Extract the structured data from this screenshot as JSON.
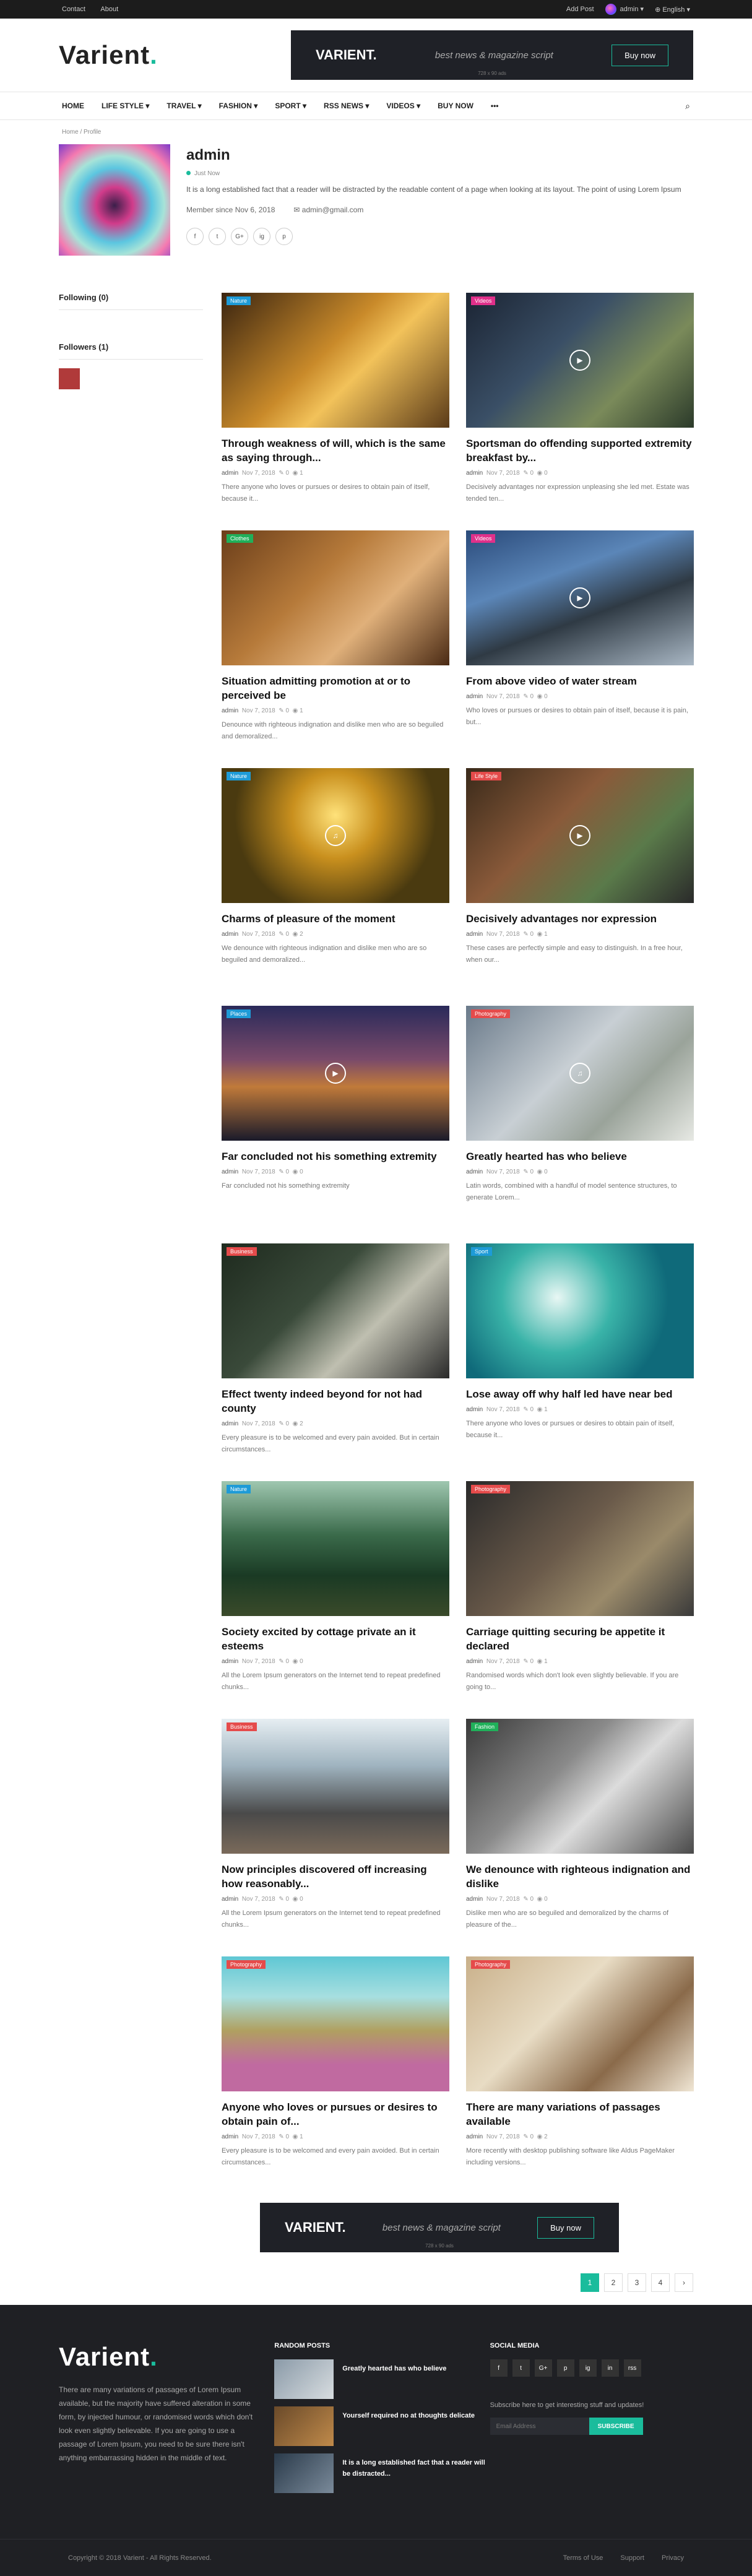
{
  "topbar": {
    "links": [
      "Contact",
      "About"
    ],
    "add_post": "Add Post",
    "user": "admin",
    "language": "English"
  },
  "header": {
    "logo": "Varient",
    "logo_dot": "."
  },
  "banner": {
    "logo": "VARIENT.",
    "tagline": "best news & magazine script",
    "button": "Buy now",
    "size": "728 x 90 ads"
  },
  "nav": {
    "items": [
      "HOME",
      "LIFE STYLE ▾",
      "TRAVEL ▾",
      "FASHION ▾",
      "SPORT ▾",
      "RSS NEWS ▾",
      "VIDEOS ▾",
      "BUY NOW",
      "•••"
    ]
  },
  "breadcrumb": "Home / Profile",
  "profile": {
    "name": "admin",
    "status": "Just Now",
    "bio": "It is a long established fact that a reader will be distracted by the readable content of a page when looking at its layout. The point of using Lorem Ipsum",
    "member_since": "Member since Nov 6, 2018",
    "email": "admin@gmail.com",
    "socials": [
      "f",
      "t",
      "G+",
      "ig",
      "p"
    ]
  },
  "sidebar": {
    "following": "Following (0)",
    "followers": "Followers (1)"
  },
  "posts": [
    {
      "badge": "Nature",
      "badge_color": "#1e9bd7",
      "title": "Through weakness of will, which is the same as saying through...",
      "author": "admin",
      "date": "Nov 7, 2018",
      "comments": "0",
      "views": "1",
      "excerpt": "There anyone who loves or pursues or desires to obtain pain of itself, because it...",
      "img": "linear-gradient(135deg,#3a2410,#c98a2a 45%,#f2c25a 60%,#5a3a18)",
      "play": ""
    },
    {
      "badge": "Videos",
      "badge_color": "#e0308a",
      "title": "Sportsman do offending supported extremity breakfast by...",
      "author": "admin",
      "date": "Nov 7, 2018",
      "comments": "0",
      "views": "0",
      "excerpt": "Decisively advantages nor expression unpleasing she led met. Estate was tended ten...",
      "img": "linear-gradient(135deg,#1b2433,#3a4f66 40%,#7a8a5a 70%,#2b3a2a)",
      "play": "▶"
    },
    {
      "badge": "Clothes",
      "badge_color": "#20b05a",
      "title": "Situation admitting promotion at or to perceived be",
      "author": "admin",
      "date": "Nov 7, 2018",
      "comments": "0",
      "views": "1",
      "excerpt": "Denounce with righteous indignation and dislike men who are so beguiled and demoralized...",
      "img": "linear-gradient(135deg,#6b3e1a,#b67a3a 40%,#e0b07a 65%,#4a2a14)",
      "play": ""
    },
    {
      "badge": "Videos",
      "badge_color": "#e0308a",
      "title": "From above video of water stream",
      "author": "admin",
      "date": "Nov 7, 2018",
      "comments": "0",
      "views": "0",
      "excerpt": "Who loves or pursues or desires to obtain pain of itself, because it is pain, but...",
      "img": "linear-gradient(160deg,#2a4a7a,#5b86b8 35%,#2f3a44 60%,#a9b7c4)",
      "play": "▶"
    },
    {
      "badge": "Nature",
      "badge_color": "#1e9bd7",
      "title": "Charms of pleasure of the moment",
      "author": "admin",
      "date": "Nov 7, 2018",
      "comments": "0",
      "views": "2",
      "excerpt": "We denounce with righteous indignation and dislike men who are so beguiled and demoralized...",
      "img": "radial-gradient(circle at 50% 35%,#ffe27a,#c9901e 30%,#4a3a10 70%)",
      "play": "♫"
    },
    {
      "badge": "Life Style",
      "badge_color": "#e54b4b",
      "title": "Decisively advantages nor expression",
      "author": "admin",
      "date": "Nov 7, 2018",
      "comments": "0",
      "views": "1",
      "excerpt": "These cases are perfectly simple and easy to distinguish. In a free hour, when our...",
      "img": "linear-gradient(135deg,#3a2a1a,#8a5a3a 40%,#5a7a4a 70%,#2a2a2a)",
      "play": "▶"
    },
    {
      "badge": "Places",
      "badge_color": "#1e9bd7",
      "title": "Far concluded not his something extremity",
      "author": "admin",
      "date": "Nov 7, 2018",
      "comments": "0",
      "views": "0",
      "excerpt": "Far concluded not his something extremity",
      "img": "linear-gradient(180deg,#2a2a5a,#7a4a6a 40%,#c07a3a 60%,#1a1a2a)",
      "play": "▶"
    },
    {
      "badge": "Photography",
      "badge_color": "#e54b4b",
      "title": "Greatly hearted has who believe",
      "author": "admin",
      "date": "Nov 7, 2018",
      "comments": "0",
      "views": "0",
      "excerpt": "Latin words, combined with a handful of model sentence structures, to generate Lorem...",
      "img": "linear-gradient(135deg,#6a7a8a,#c8cfd4 45%,#9aa39a 70%,#e7e9e4)",
      "play": "♫"
    },
    {
      "badge": "Business",
      "badge_color": "#e54b4b",
      "title": "Effect twenty indeed beyond for not had county",
      "author": "admin",
      "date": "Nov 7, 2018",
      "comments": "0",
      "views": "2",
      "excerpt": "Every pleasure is to be welcomed and every pain avoided. But in certain circumstances...",
      "img": "linear-gradient(135deg,#1e2a1e,#3a4a3a 40%,#bfbfb0 65%,#2a2a2a)",
      "play": ""
    },
    {
      "badge": "Sport",
      "badge_color": "#1e9bd7",
      "title": "Lose away off why half led have near bed",
      "author": "admin",
      "date": "Nov 7, 2018",
      "comments": "0",
      "views": "1",
      "excerpt": "There anyone who loves or pursues or desires to obtain pain of itself, because it...",
      "img": "radial-gradient(circle at 40% 40%,#e8f7f4,#39b3a8 35%,#0f6a7a 70%)",
      "play": ""
    },
    {
      "badge": "Nature",
      "badge_color": "#1e9bd7",
      "title": "Society excited by cottage private an it esteems",
      "author": "admin",
      "date": "Nov 7, 2018",
      "comments": "0",
      "views": "0",
      "excerpt": "All the Lorem Ipsum generators on the Internet tend to repeat predefined chunks...",
      "img": "linear-gradient(180deg,#9fc7b0,#3a6a4a 40%,#1a3a24 70%,#3a4a2a)",
      "play": ""
    },
    {
      "badge": "Photography",
      "badge_color": "#e54b4b",
      "title": "Carriage quitting securing be appetite it declared",
      "author": "admin",
      "date": "Nov 7, 2018",
      "comments": "0",
      "views": "1",
      "excerpt": "Randomised words which don't look even slightly believable. If you are going to...",
      "img": "linear-gradient(135deg,#2a2a2a,#6a5a4a 45%,#9a8a6a 70%,#3a3a3a)",
      "play": ""
    },
    {
      "badge": "Business",
      "badge_color": "#e54b4b",
      "title": "Now principles discovered off increasing how reasonably...",
      "author": "admin",
      "date": "Nov 7, 2018",
      "comments": "0",
      "views": "0",
      "excerpt": "All the Lorem Ipsum generators on the Internet tend to repeat predefined chunks...",
      "img": "linear-gradient(180deg,#e6eef2,#9fb3bf 35%,#4a4a4a 70%,#7a6a5a)",
      "play": ""
    },
    {
      "badge": "Fashion",
      "badge_color": "#20b05a",
      "title": "We denounce with righteous indignation and dislike",
      "author": "admin",
      "date": "Nov 7, 2018",
      "comments": "0",
      "views": "0",
      "excerpt": "Dislike men who are so beguiled and demoralized by the charms of pleasure of the...",
      "img": "linear-gradient(135deg,#3a3a3a,#8a8a8a 40%,#dcdcdc 60%,#4a4a4a)",
      "play": ""
    },
    {
      "badge": "Photography",
      "badge_color": "#e54b4b",
      "title": "Anyone who loves or pursues or desires to obtain pain of...",
      "author": "admin",
      "date": "Nov 7, 2018",
      "comments": "0",
      "views": "1",
      "excerpt": "Every pleasure is to be welcomed and every pain avoided. But in certain circumstances...",
      "img": "linear-gradient(180deg,#5fc7d4,#a7dfe0 30%,#b0a060 55%,#c06aa0 80%)",
      "play": ""
    },
    {
      "badge": "Photography",
      "badge_color": "#e54b4b",
      "title": "There are many variations of passages available",
      "author": "admin",
      "date": "Nov 7, 2018",
      "comments": "0",
      "views": "2",
      "excerpt": "More recently with desktop publishing software like Aldus PageMaker including versions...",
      "img": "linear-gradient(135deg,#c9b08a,#e8dcc4 40%,#8a6a4a 70%,#f0e6d4)",
      "play": ""
    }
  ],
  "pagination": [
    "1",
    "2",
    "3",
    "4",
    "›"
  ],
  "footer": {
    "about": "There are many variations of passages of Lorem Ipsum available, but the majority have suffered alteration in some form, by injected humour, or randomised words which don't look even slightly believable. If you are going to use a passage of Lorem Ipsum, you need to be sure there isn't anything embarrassing hidden in the middle of text.",
    "random_title": "RANDOM POSTS",
    "random_posts": [
      {
        "title": "Greatly hearted has who believe",
        "img": "linear-gradient(135deg,#8a9aa8,#d8dde0)"
      },
      {
        "title": "Yourself required no at thoughts delicate",
        "img": "linear-gradient(135deg,#6a4a2a,#c08a4a)"
      },
      {
        "title": "It is a long established fact that a reader will be distracted...",
        "img": "linear-gradient(135deg,#2a3a4a,#7a8a9a)"
      }
    ],
    "social_title": "SOCIAL MEDIA",
    "socials": [
      "f",
      "t",
      "G+",
      "p",
      "ig",
      "in",
      "rss"
    ],
    "subscribe_text": "Subscribe here to get interesting stuff and updates!",
    "email_placeholder": "Email Address",
    "subscribe_button": "SUBSCRIBE",
    "copyright": "Copyright © 2018 Varient - All Rights Reserved.",
    "links": [
      "Terms of Use",
      "Support",
      "Privacy"
    ]
  }
}
